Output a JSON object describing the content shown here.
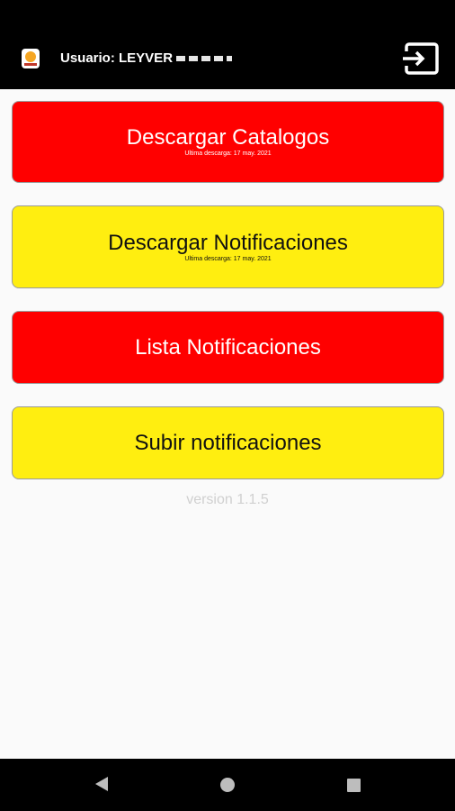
{
  "header": {
    "title": "Usuario: LEYVER"
  },
  "buttons": {
    "catalogos": {
      "label": "Descargar Catalogos",
      "sub": "Ultima descarga: 17 may. 2021"
    },
    "notificaciones": {
      "label": "Descargar Notificaciones",
      "sub": "Ultima descarga: 17 may. 2021"
    },
    "lista": {
      "label": "Lista Notificaciones"
    },
    "subir": {
      "label": "Subir notificaciones"
    }
  },
  "version": "version 1.1.5",
  "colors": {
    "red": "#ff0000",
    "yellow": "#ffee10",
    "appbar": "#000000"
  },
  "icons": {
    "logout": "logout-icon",
    "logo": "app-logo-icon",
    "back": "back-icon",
    "home": "home-icon",
    "recents": "recents-icon"
  }
}
